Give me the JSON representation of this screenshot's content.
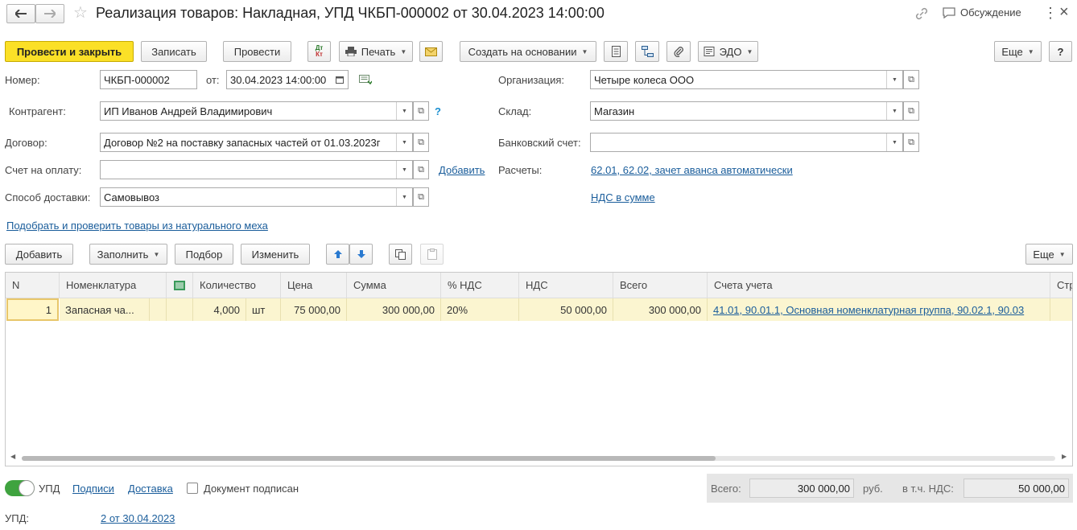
{
  "window": {
    "title": "Реализация товаров: Накладная, УПД ЧКБП-000002 от 30.04.2023 14:00:00",
    "discussion": "Обсуждение"
  },
  "toolbar": {
    "post_close": "Провести и закрыть",
    "save": "Записать",
    "post": "Провести",
    "dt_kt": "Дт Кт",
    "print": "Печать",
    "create_based": "Создать на основании",
    "edo": "ЭДО",
    "more": "Еще",
    "help": "?"
  },
  "form": {
    "number_label": "Номер:",
    "number_value": "ЧКБП-000002",
    "date_label": "от:",
    "date_value": "30.04.2023 14:00:00",
    "org_label": "Организация:",
    "org_value": "Четыре колеса ООО",
    "contractor_label": "Контрагент:",
    "contractor_value": "ИП Иванов Андрей Владимирович",
    "contractor_help": "?",
    "warehouse_label": "Склад:",
    "warehouse_value": "Магазин",
    "contract_label": "Договор:",
    "contract_value": "Договор №2 на поставку запасных частей от 01.03.2023г",
    "bank_label": "Банковский счет:",
    "bank_value": "",
    "invoice_label": "Счет на оплату:",
    "invoice_value": "",
    "invoice_add": "Добавить",
    "settlements_label": "Расчеты:",
    "settlements_link": "62.01, 62.02, зачет аванса автоматически",
    "delivery_label": "Способ доставки:",
    "delivery_value": "Самовывоз",
    "vat_link": "НДС в сумме",
    "fur_link": "Подобрать и проверить товары из натурального меха"
  },
  "table_toolbar": {
    "add": "Добавить",
    "fill": "Заполнить",
    "pick": "Подбор",
    "change": "Изменить",
    "more": "Еще"
  },
  "table": {
    "headers": {
      "n": "N",
      "item": "Номенклатура",
      "qty": "Количество",
      "price": "Цена",
      "sum": "Сумма",
      "vat_rate": "% НДС",
      "vat": "НДС",
      "total": "Всего",
      "accounts": "Счета учета",
      "extra": "Стр"
    },
    "rows": [
      {
        "n": "1",
        "item": "Запасная ча...",
        "qty": "4,000",
        "unit": "шт",
        "price": "75 000,00",
        "sum": "300 000,00",
        "vat_rate": "20%",
        "vat": "50 000,00",
        "total": "300 000,00",
        "accounts": "41.01, 90.01.1, Основная номенклатурная группа, 90.02.1, 90.03"
      }
    ]
  },
  "footer": {
    "upd_toggle": "УПД",
    "signatures": "Подписи",
    "delivery": "Доставка",
    "signed": "Документ подписан",
    "total_label": "Всего:",
    "total_value": "300 000,00",
    "currency": "руб.",
    "vat_label": "в т.ч. НДС:",
    "vat_value": "50 000,00",
    "upd_label": "УПД:",
    "upd_link": "2 от 30.04.2023"
  },
  "colors": {
    "primary_button": "#fbe027",
    "link": "#1a5d9b",
    "row_highlight": "#fbf5d0",
    "toggle_on": "#3fa33f"
  }
}
